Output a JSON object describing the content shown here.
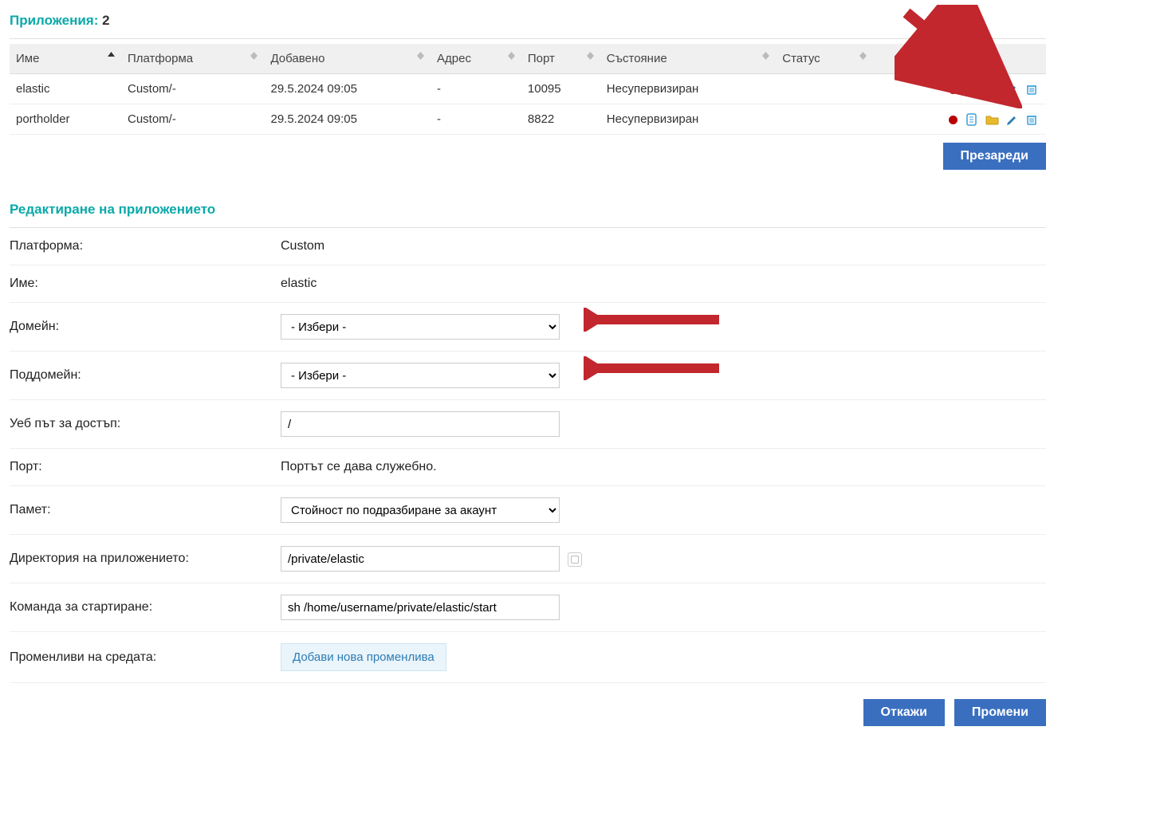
{
  "apps": {
    "title_label": "Приложения:",
    "count": "2",
    "headers": {
      "name": "Име",
      "platform": "Платформа",
      "added": "Добавено",
      "address": "Адрес",
      "port": "Порт",
      "state": "Състояние",
      "status": "Статус"
    },
    "rows": [
      {
        "name": "elastic",
        "platform": "Custom/-",
        "added": "29.5.2024 09:05",
        "address": "-",
        "port": "10095",
        "state": "Несупервизиран",
        "status": ""
      },
      {
        "name": "portholder",
        "platform": "Custom/-",
        "added": "29.5.2024 09:05",
        "address": "-",
        "port": "8822",
        "state": "Несупервизиран",
        "status": ""
      }
    ],
    "reload_label": "Презареди"
  },
  "edit": {
    "title": "Редактиране на приложението",
    "fields": {
      "platform_label": "Платформа:",
      "platform_value": "Custom",
      "name_label": "Име:",
      "name_value": "elastic",
      "domain_label": "Домейн:",
      "domain_value": "- Избери -",
      "subdomain_label": "Поддомейн:",
      "subdomain_value": "- Избери -",
      "webpath_label": "Уеб път за достъп:",
      "webpath_value": "/",
      "port_label": "Порт:",
      "port_text": "Портът се дава служебно.",
      "memory_label": "Памет:",
      "memory_value": "Стойност по подразбиране за акаунт",
      "appdir_label": "Директория на приложението:",
      "appdir_value": "/private/elastic",
      "startcmd_label": "Команда за стартиране:",
      "startcmd_value": "sh /home/username/private/elastic/start",
      "envvars_label": "Променливи на средата:",
      "envvars_button": "Добави нова променлива"
    },
    "cancel_label": "Откажи",
    "submit_label": "Промени"
  },
  "colors": {
    "teal": "#0aa9a9",
    "primary": "#3a6fc0",
    "red": "#c1272d"
  }
}
